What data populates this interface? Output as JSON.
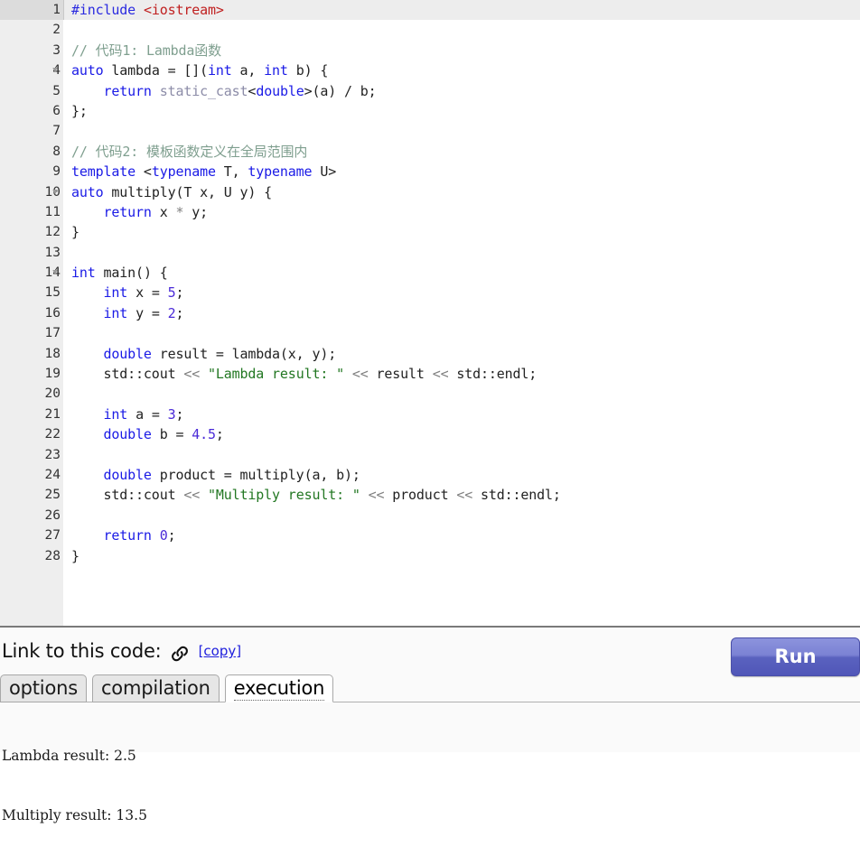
{
  "editor": {
    "language": "cpp",
    "current_line": 1,
    "total_lines": 28,
    "lines": [
      {
        "num": "1",
        "fold": false,
        "current": true,
        "tokens": [
          {
            "t": "#include",
            "c": "pp"
          },
          {
            "t": " ",
            "c": "pl"
          },
          {
            "t": "<iostream>",
            "c": "inc"
          }
        ]
      },
      {
        "num": "2",
        "fold": false,
        "current": false,
        "tokens": []
      },
      {
        "num": "3",
        "fold": false,
        "current": false,
        "tokens": [
          {
            "t": "// 代码1: Lambda函数",
            "c": "com"
          }
        ]
      },
      {
        "num": "4",
        "fold": true,
        "current": false,
        "tokens": [
          {
            "t": "auto",
            "c": "kw"
          },
          {
            "t": " lambda = [](",
            "c": "pl"
          },
          {
            "t": "int",
            "c": "kw"
          },
          {
            "t": " a, ",
            "c": "pl"
          },
          {
            "t": "int",
            "c": "kw"
          },
          {
            "t": " b) {",
            "c": "pl"
          }
        ]
      },
      {
        "num": "5",
        "fold": false,
        "current": false,
        "tokens": [
          {
            "t": "    ",
            "c": "pl"
          },
          {
            "t": "return",
            "c": "kw"
          },
          {
            "t": " ",
            "c": "pl"
          },
          {
            "t": "static_cast",
            "c": "kw2"
          },
          {
            "t": "<",
            "c": "pl"
          },
          {
            "t": "double",
            "c": "kw"
          },
          {
            "t": ">(a) / b;",
            "c": "pl"
          }
        ]
      },
      {
        "num": "6",
        "fold": false,
        "current": false,
        "tokens": [
          {
            "t": "};",
            "c": "pl"
          }
        ]
      },
      {
        "num": "7",
        "fold": false,
        "current": false,
        "tokens": []
      },
      {
        "num": "8",
        "fold": false,
        "current": false,
        "tokens": [
          {
            "t": "// 代码2: 模板函数定义在全局范围内",
            "c": "com"
          }
        ]
      },
      {
        "num": "9",
        "fold": false,
        "current": false,
        "tokens": [
          {
            "t": "template",
            "c": "kw"
          },
          {
            "t": " <",
            "c": "pl"
          },
          {
            "t": "typename",
            "c": "kw"
          },
          {
            "t": " T, ",
            "c": "pl"
          },
          {
            "t": "typename",
            "c": "kw"
          },
          {
            "t": " U>",
            "c": "pl"
          }
        ]
      },
      {
        "num": "10",
        "fold": true,
        "current": false,
        "tokens": [
          {
            "t": "auto",
            "c": "kw"
          },
          {
            "t": " multiply(T x, U y) {",
            "c": "pl"
          }
        ]
      },
      {
        "num": "11",
        "fold": false,
        "current": false,
        "tokens": [
          {
            "t": "    ",
            "c": "pl"
          },
          {
            "t": "return",
            "c": "kw"
          },
          {
            "t": " x ",
            "c": "pl"
          },
          {
            "t": "*",
            "c": "op"
          },
          {
            "t": " y;",
            "c": "pl"
          }
        ]
      },
      {
        "num": "12",
        "fold": false,
        "current": false,
        "tokens": [
          {
            "t": "}",
            "c": "pl"
          }
        ]
      },
      {
        "num": "13",
        "fold": false,
        "current": false,
        "tokens": []
      },
      {
        "num": "14",
        "fold": true,
        "current": false,
        "tokens": [
          {
            "t": "int",
            "c": "kw"
          },
          {
            "t": " main() {",
            "c": "pl"
          }
        ]
      },
      {
        "num": "15",
        "fold": false,
        "current": false,
        "tokens": [
          {
            "t": "    ",
            "c": "pl"
          },
          {
            "t": "int",
            "c": "kw"
          },
          {
            "t": " x = ",
            "c": "pl"
          },
          {
            "t": "5",
            "c": "num"
          },
          {
            "t": ";",
            "c": "pl"
          }
        ]
      },
      {
        "num": "16",
        "fold": false,
        "current": false,
        "tokens": [
          {
            "t": "    ",
            "c": "pl"
          },
          {
            "t": "int",
            "c": "kw"
          },
          {
            "t": " y = ",
            "c": "pl"
          },
          {
            "t": "2",
            "c": "num"
          },
          {
            "t": ";",
            "c": "pl"
          }
        ]
      },
      {
        "num": "17",
        "fold": false,
        "current": false,
        "tokens": []
      },
      {
        "num": "18",
        "fold": false,
        "current": false,
        "tokens": [
          {
            "t": "    ",
            "c": "pl"
          },
          {
            "t": "double",
            "c": "kw"
          },
          {
            "t": " result = lambda(x, y);",
            "c": "pl"
          }
        ]
      },
      {
        "num": "19",
        "fold": false,
        "current": false,
        "tokens": [
          {
            "t": "    std::cout ",
            "c": "pl"
          },
          {
            "t": "<<",
            "c": "op"
          },
          {
            "t": " ",
            "c": "pl"
          },
          {
            "t": "\"Lambda result: \"",
            "c": "str"
          },
          {
            "t": " ",
            "c": "pl"
          },
          {
            "t": "<<",
            "c": "op"
          },
          {
            "t": " result ",
            "c": "pl"
          },
          {
            "t": "<<",
            "c": "op"
          },
          {
            "t": " std::endl;",
            "c": "pl"
          }
        ]
      },
      {
        "num": "20",
        "fold": false,
        "current": false,
        "tokens": []
      },
      {
        "num": "21",
        "fold": false,
        "current": false,
        "tokens": [
          {
            "t": "    ",
            "c": "pl"
          },
          {
            "t": "int",
            "c": "kw"
          },
          {
            "t": " a = ",
            "c": "pl"
          },
          {
            "t": "3",
            "c": "num"
          },
          {
            "t": ";",
            "c": "pl"
          }
        ]
      },
      {
        "num": "22",
        "fold": false,
        "current": false,
        "tokens": [
          {
            "t": "    ",
            "c": "pl"
          },
          {
            "t": "double",
            "c": "kw"
          },
          {
            "t": " b = ",
            "c": "pl"
          },
          {
            "t": "4.5",
            "c": "num"
          },
          {
            "t": ";",
            "c": "pl"
          }
        ]
      },
      {
        "num": "23",
        "fold": false,
        "current": false,
        "tokens": []
      },
      {
        "num": "24",
        "fold": false,
        "current": false,
        "tokens": [
          {
            "t": "    ",
            "c": "pl"
          },
          {
            "t": "double",
            "c": "kw"
          },
          {
            "t": " product = multiply(a, b);",
            "c": "pl"
          }
        ]
      },
      {
        "num": "25",
        "fold": false,
        "current": false,
        "tokens": [
          {
            "t": "    std::cout ",
            "c": "pl"
          },
          {
            "t": "<<",
            "c": "op"
          },
          {
            "t": " ",
            "c": "pl"
          },
          {
            "t": "\"Multiply result: \"",
            "c": "str"
          },
          {
            "t": " ",
            "c": "pl"
          },
          {
            "t": "<<",
            "c": "op"
          },
          {
            "t": " product ",
            "c": "pl"
          },
          {
            "t": "<<",
            "c": "op"
          },
          {
            "t": " std::endl;",
            "c": "pl"
          }
        ]
      },
      {
        "num": "26",
        "fold": false,
        "current": false,
        "tokens": []
      },
      {
        "num": "27",
        "fold": false,
        "current": false,
        "tokens": [
          {
            "t": "    ",
            "c": "pl"
          },
          {
            "t": "return",
            "c": "kw"
          },
          {
            "t": " ",
            "c": "pl"
          },
          {
            "t": "0",
            "c": "num"
          },
          {
            "t": ";",
            "c": "pl"
          }
        ]
      },
      {
        "num": "28",
        "fold": false,
        "current": false,
        "tokens": [
          {
            "t": "}",
            "c": "pl"
          }
        ]
      }
    ]
  },
  "link_bar": {
    "label": "Link to this code:",
    "chain_icon": "link-icon",
    "copy_label": "[copy]"
  },
  "run": {
    "label": "Run"
  },
  "tabs": {
    "active": "execution",
    "items": [
      {
        "id": "options",
        "label": "options",
        "active": false
      },
      {
        "id": "compilation",
        "label": "compilation",
        "active": false
      },
      {
        "id": "execution",
        "label": "execution",
        "active": true
      }
    ]
  },
  "output": {
    "lines": [
      "Lambda result: 2.5",
      "Multiply result: 13.5"
    ]
  },
  "colors": {
    "keyword": "#1a1ae6",
    "string": "#227722",
    "comment": "#7f9f8f",
    "number": "#4a2ad8",
    "operator": "#808080",
    "preprocessor": "#2a2ae0",
    "include_path": "#c02020",
    "gutter_bg": "#eeeeee",
    "current_line_bg": "#ededed",
    "run_button": "#5a62bf",
    "link": "#2020dd"
  }
}
